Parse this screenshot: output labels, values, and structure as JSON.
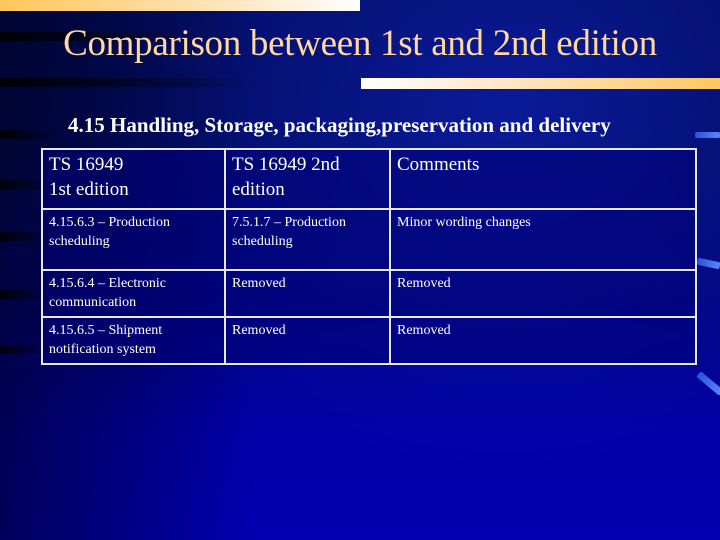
{
  "slide": {
    "title": "Comparison between 1st and 2nd edition",
    "subtitle": "4.15 Handling, Storage, packaging,preservation and delivery",
    "colors": {
      "background": "#0000a0",
      "title_text": "#ffd9a0",
      "accent_bar_start": "#ffc65a",
      "accent_bar_end": "#ffffff",
      "table_border": "#e8e8f0"
    }
  },
  "table": {
    "headers": [
      "TS 16949\n1st edition",
      "TS 16949  2nd edition",
      "Comments"
    ],
    "header_lines": [
      [
        "TS 16949",
        "1st edition"
      ],
      [
        "TS 16949  2nd",
        "edition"
      ],
      [
        "Comments"
      ]
    ],
    "rows": [
      {
        "first_edition": [
          "4.15.6.3 – Production",
          "scheduling"
        ],
        "second_edition": [
          "7.5.1.7 – Production",
          "scheduling"
        ],
        "comments": "Minor wording changes"
      },
      {
        "first_edition": [
          "4.15.6.4 – Electronic",
          "communication"
        ],
        "second_edition": [
          "Removed"
        ],
        "comments": "Removed"
      },
      {
        "first_edition": [
          "4.15.6.5 – Shipment",
          "notification system"
        ],
        "second_edition": [
          "Removed"
        ],
        "comments": "Removed"
      }
    ]
  }
}
